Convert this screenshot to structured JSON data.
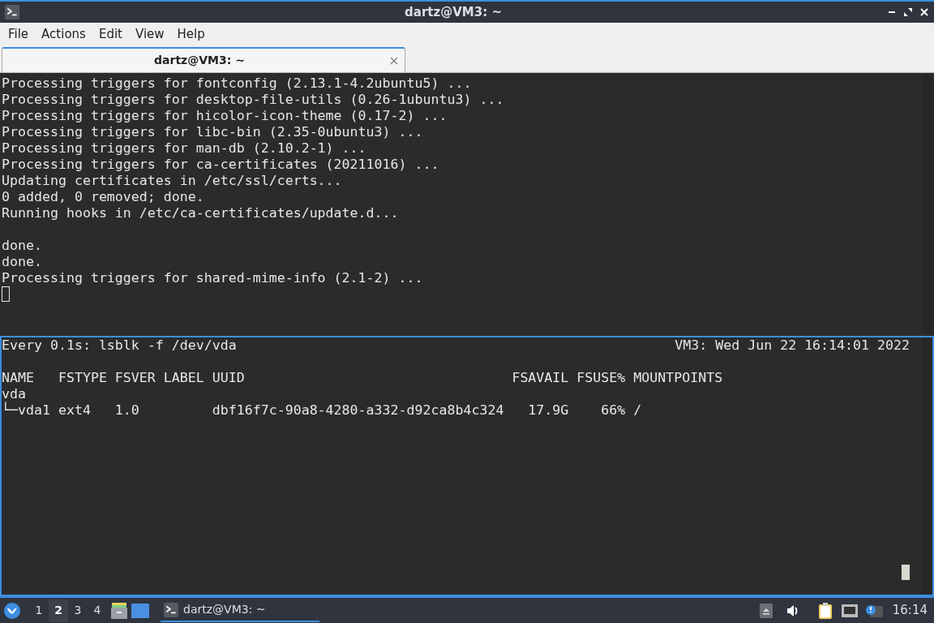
{
  "window": {
    "title": "dartz@VM3: ~"
  },
  "menu": [
    "File",
    "Actions",
    "Edit",
    "View",
    "Help"
  ],
  "tabs": [
    {
      "label": "dartz@VM3: ~",
      "selected": true
    }
  ],
  "top_pane": {
    "blocks": [
      [
        "Processing triggers for fontconfig (2.13.1-4.2ubuntu5) ...",
        "Processing triggers for desktop-file-utils (0.26-1ubuntu3) ...",
        "Processing triggers for hicolor-icon-theme (0.17-2) ...",
        "Processing triggers for libc-bin (2.35-0ubuntu3) ...",
        "Processing triggers for man-db (2.10.2-1) ...",
        "Processing triggers for ca-certificates (20211016) ...",
        "Updating certificates in /etc/ssl/certs...",
        "0 added, 0 removed; done.",
        "Running hooks in /etc/ca-certificates/update.d..."
      ],
      [
        "done.",
        "done.",
        "Processing triggers for shared-mime-info (2.1-2) ..."
      ]
    ],
    "focused": false
  },
  "bottom_pane": {
    "header_left": "Every 0.1s: lsblk -f /dev/vda",
    "header_right": "VM3: Wed Jun 22 16:14:01 2022",
    "lines": [
      "NAME   FSTYPE FSVER LABEL UUID                                 FSAVAIL FSUSE% MOUNTPOINTS",
      "vda",
      "└─vda1 ext4   1.0         dbf16f7c-90a8-4280-a332-d92ca8b4c324   17.9G    66% /"
    ],
    "focused": true
  },
  "taskbar": {
    "workspaces": [
      {
        "label": "1",
        "selected": false
      },
      {
        "label": "2",
        "selected": true
      },
      {
        "label": "3",
        "selected": false
      },
      {
        "label": "4",
        "selected": false
      }
    ],
    "tasks": [
      {
        "label": "dartz@VM3: ~",
        "selected": true
      }
    ],
    "clock": "16:14"
  }
}
